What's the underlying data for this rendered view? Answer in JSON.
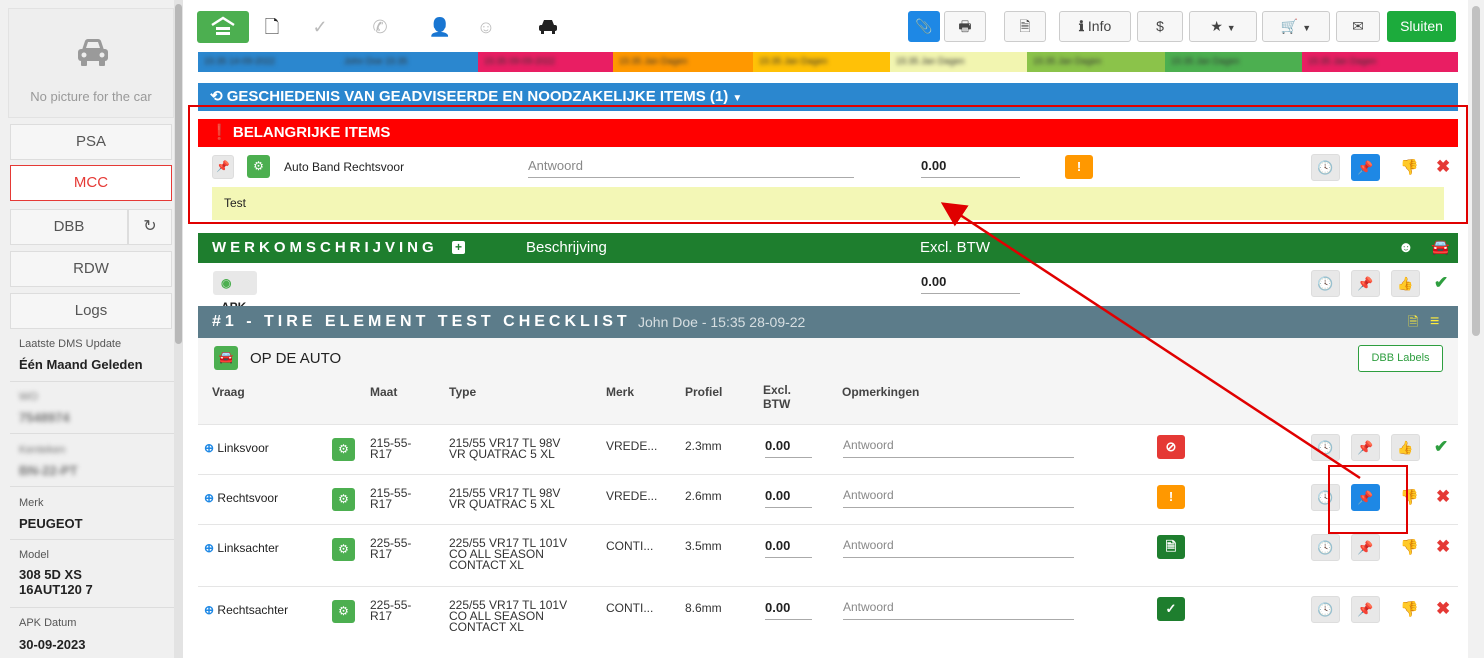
{
  "sidebar": {
    "no_picture": "No picture for the car",
    "buttons": [
      "PSA",
      "MCC",
      "DBB",
      "RDW",
      "Logs"
    ],
    "meta": [
      {
        "label": "Laatste DMS Update",
        "value": "Één Maand Geleden"
      },
      {
        "label": "WO",
        "value": "7548974"
      },
      {
        "label": "Kenteken",
        "value": "BN-22-PT"
      },
      {
        "label": "Merk",
        "value": "PEUGEOT"
      },
      {
        "label": "Model",
        "value": "308 5D XS 16AUT120 7"
      },
      {
        "label": "APK Datum",
        "value": "30-09-2023"
      }
    ]
  },
  "toolbar": {
    "info_label": "Info",
    "dollar": "$",
    "close_label": "Sluiten"
  },
  "strip": [
    "15:35 14-09-2022",
    "John Doe 15:35",
    "15:35 09-09-2022",
    "15:35 Jan Dagen",
    "15:35 Jan Dagen",
    "15:35 Jan Dagen",
    "15:35 Jan Dagen",
    "15:35 Jan Dagen",
    "15:35 Jan Dagen"
  ],
  "history_bar": {
    "title": "GESCHIEDENIS VAN GEADVISEERDE EN NOODZAKELIJKE ITEMS (1)"
  },
  "important": {
    "title": "BELANGRIJKE ITEMS",
    "item_name": "Auto Band Rechtsvoor",
    "answer_placeholder": "Antwoord",
    "price": "0.00",
    "note": "Test"
  },
  "work": {
    "title": "WERKOMSCHRIJVING",
    "col_desc": "Beschrijving",
    "col_price": "Excl. BTW",
    "item": "APK",
    "item_price": "0.00"
  },
  "checklist": {
    "title": "#1 - TIRE ELEMENT TEST CHECKLIST",
    "meta": "John Doe - 15:35 28-09-22",
    "section": "OP DE AUTO",
    "dbb_labels": "DBB Labels",
    "headers": [
      "Vraag",
      "Maat",
      "Type",
      "Merk",
      "Profiel",
      "Excl.",
      "BTW",
      "Opmerkingen"
    ],
    "rows": [
      {
        "vraag": "Linksvoor",
        "maat1": "215-55-",
        "maat2": "R17",
        "type1": "215/55 VR17 TL 98V",
        "type2": "VR QUATRAC 5 XL",
        "type3": "",
        "merk": "VREDE...",
        "profiel": "2.3mm",
        "price": "0.00",
        "placeholder": "Antwoord"
      },
      {
        "vraag": "Rechtsvoor",
        "maat1": "215-55-",
        "maat2": "R17",
        "type1": "215/55 VR17 TL 98V",
        "type2": "VR QUATRAC 5 XL",
        "type3": "",
        "merk": "VREDE...",
        "profiel": "2.6mm",
        "price": "0.00",
        "placeholder": "Antwoord"
      },
      {
        "vraag": "Linksachter",
        "maat1": "225-55-",
        "maat2": "R17",
        "type1": "225/55 VR17 TL 101V",
        "type2": "CO ALL SEASON",
        "type3": "CONTACT XL",
        "merk": "CONTI...",
        "profiel": "3.5mm",
        "price": "0.00",
        "placeholder": "Antwoord"
      },
      {
        "vraag": "Rechtsachter",
        "maat1": "225-55-",
        "maat2": "R17",
        "type1": "225/55 VR17 TL 101V",
        "type2": "CO ALL SEASON",
        "type3": "CONTACT XL",
        "merk": "CONTI...",
        "profiel": "8.6mm",
        "price": "0.00",
        "placeholder": "Antwoord"
      }
    ]
  },
  "colors": {
    "red": "#ff0000",
    "blue": "#2b87cf",
    "green": "#1e7e2e",
    "slate": "#5c7c8a",
    "accent": "#1e88e5",
    "success": "#1cab3c"
  }
}
